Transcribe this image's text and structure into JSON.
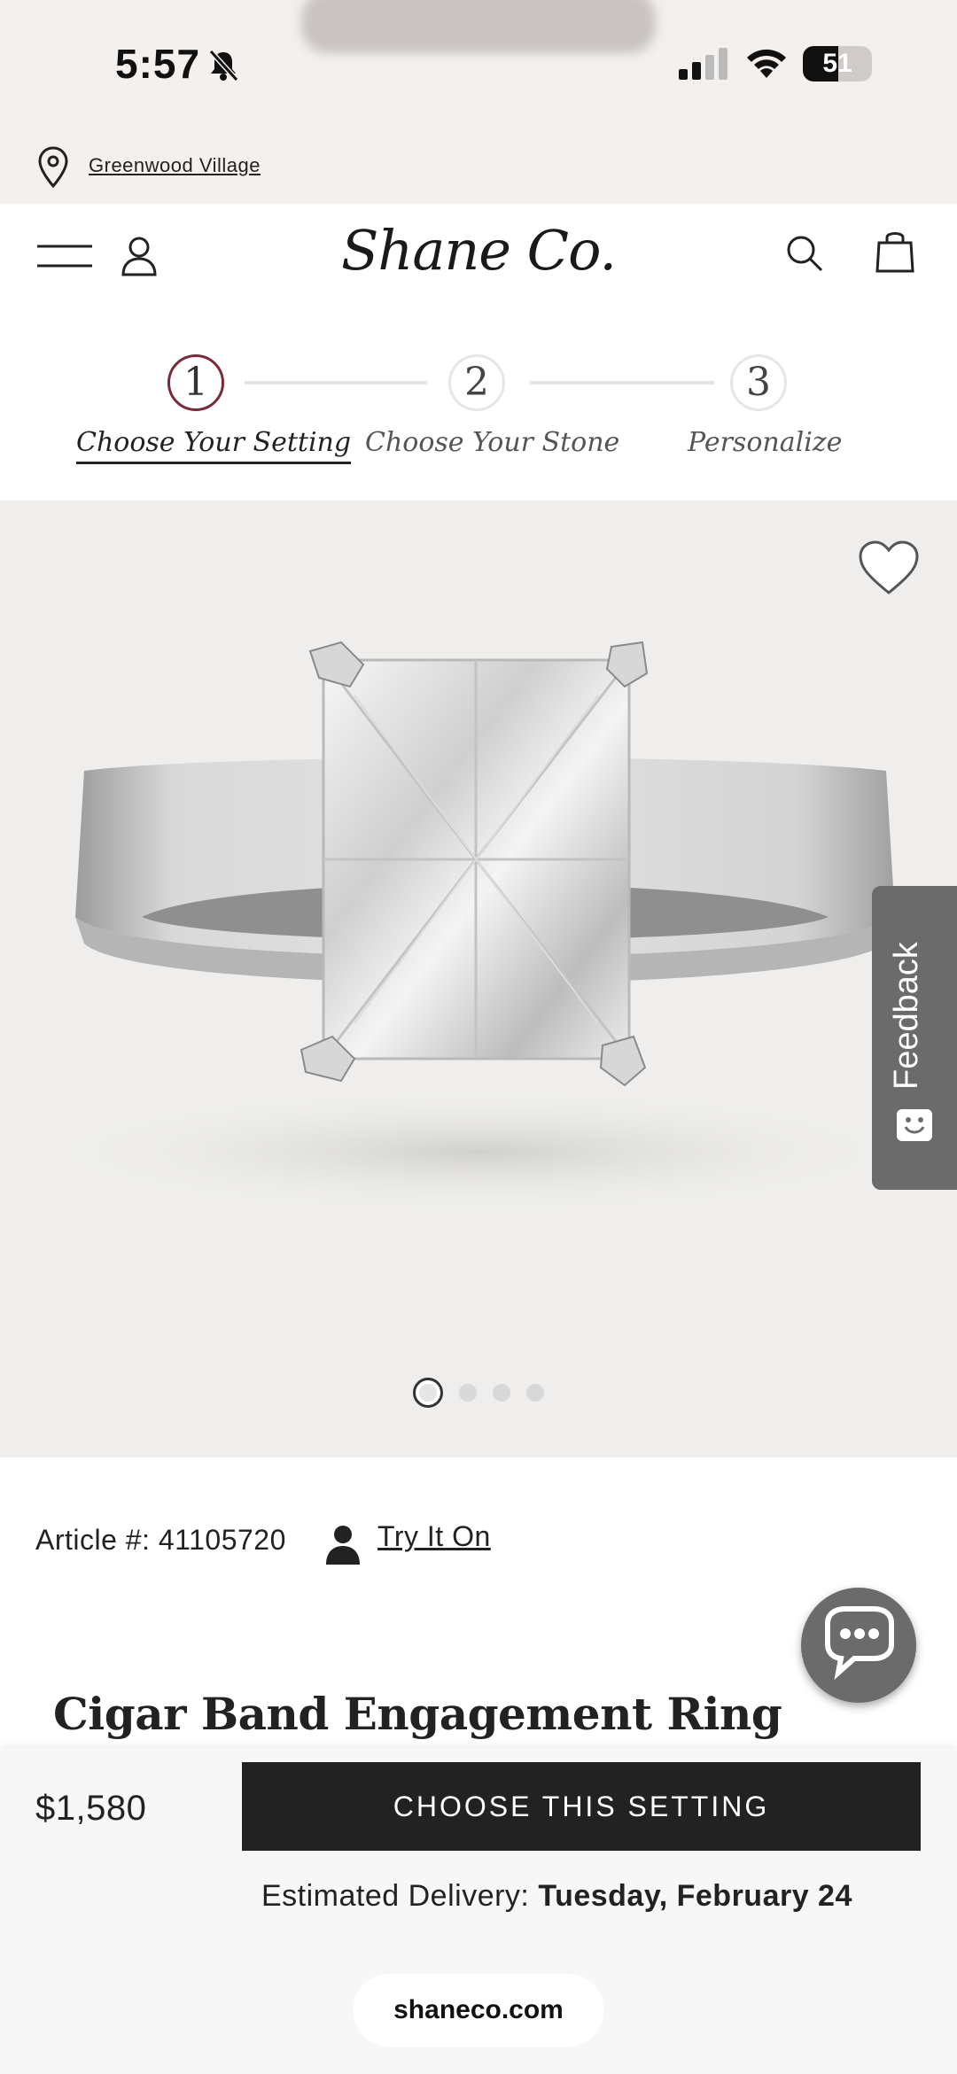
{
  "status_bar": {
    "time": "5:57",
    "battery": "51",
    "battery_level": 0.51,
    "icons": [
      "bell-slash-icon",
      "signal-icon",
      "wifi-icon",
      "battery-icon"
    ]
  },
  "location": {
    "icon": "location-pin-icon",
    "label": "Greenwood Village"
  },
  "header": {
    "logo": "Shane Co.",
    "icons": [
      "menu-icon",
      "user-icon",
      "search-icon",
      "shopping-bag-icon"
    ]
  },
  "stepper": {
    "steps": [
      {
        "number": "1",
        "label": "Choose Your Setting",
        "active": true
      },
      {
        "number": "2",
        "label": "Choose Your Stone",
        "active": false
      },
      {
        "number": "3",
        "label": "Personalize",
        "active": false
      }
    ]
  },
  "gallery": {
    "image_count": 4,
    "active_index": 0,
    "favorite_icon": "heart-icon"
  },
  "feedback": {
    "label": "Feedback"
  },
  "product": {
    "article_label": "Article #: 41105720",
    "try_on": "Try It On",
    "title": "Cigar Band Engagement Ring",
    "price": "$1,580",
    "cta": "CHOOSE THIS SETTING",
    "delivery_label": "Estimated Delivery:",
    "delivery_date": "Tuesday, February 24"
  },
  "browser": {
    "url": "shaneco.com"
  },
  "colors": {
    "accent": "#7a2a38",
    "cta_bg": "#222222",
    "feedback_bg": "#6b6b6b",
    "topbar_bg": "#f4f0ee"
  }
}
